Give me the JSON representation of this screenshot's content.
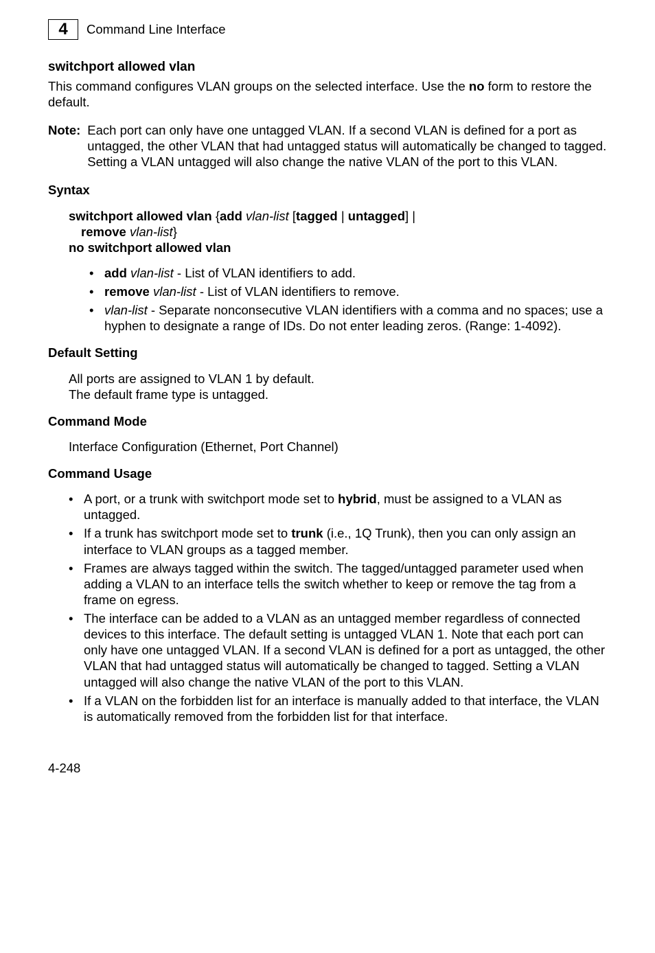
{
  "header": {
    "chapter_number": "4",
    "running_title": "Command Line Interface"
  },
  "title": "switchport allowed vlan",
  "intro": {
    "prefix": "This command configures VLAN groups on the selected interface. Use the ",
    "bold_word": "no ",
    "suffix": "form to restore the default."
  },
  "note": {
    "label": "Note:",
    "text": "Each port can only have one untagged VLAN. If a second VLAN is defined for a port as untagged, the other VLAN that had untagged status will automatically be changed to tagged.  Setting a VLAN untagged will also change the native VLAN of the port to this VLAN."
  },
  "syntax": {
    "heading": "Syntax",
    "line1": {
      "pre": "switchport allowed vlan",
      "open": " {",
      "add": "add",
      "sp1": " ",
      "vlist1": "vlan-list",
      "sp2": " [",
      "tagged": "tagged",
      "pipe1": " | ",
      "untagged": "untagged",
      "close1": "] |"
    },
    "line2": {
      "remove": "remove",
      "sp": " ",
      "vlist": "vlan-list",
      "close": "}"
    },
    "line3": "no switchport allowed vlan",
    "bullets": [
      {
        "bold": "add",
        "ital": " vlan-list",
        "rest": " - List of VLAN identifiers to add."
      },
      {
        "bold": "remove",
        "ital": " vlan-list",
        "rest": " - List of VLAN identifiers to remove."
      },
      {
        "bold": "",
        "ital": "vlan-list",
        "rest": " - Separate nonconsecutive VLAN identifiers with a comma and no spaces; use a hyphen to designate a range of IDs. Do not enter leading zeros. (Range: 1-4092)."
      }
    ]
  },
  "default_setting": {
    "heading": "Default Setting",
    "line1": "All ports are assigned to VLAN 1 by default.",
    "line2": "The default frame type is untagged."
  },
  "command_mode": {
    "heading": "Command Mode",
    "text": "Interface Configuration (Ethernet, Port Channel)"
  },
  "command_usage": {
    "heading": "Command Usage",
    "items": [
      {
        "pre": "A port, or a trunk with switchport mode set to ",
        "bold": "hybrid",
        "post": ", must be assigned to a VLAN as untagged."
      },
      {
        "pre": "If a trunk has switchport mode set to ",
        "bold": "trunk",
        "post": " (i.e., 1Q Trunk), then you can only assign an interface to VLAN groups as a tagged member."
      },
      {
        "pre": "Frames are always tagged within the switch. The tagged/untagged parameter used when adding a VLAN to an interface tells the switch whether to keep or remove the tag from a frame on egress.",
        "bold": "",
        "post": ""
      },
      {
        "pre": "The interface can be added to a VLAN as an untagged member regardless of connected devices to this interface. The default setting is untagged VLAN 1. Note that each port can only have one untagged VLAN. If a second VLAN is defined for a port as untagged, the other VLAN that had untagged status will automatically be changed to tagged.  Setting a VLAN untagged will also change the native VLAN of the port to this VLAN.",
        "bold": "",
        "post": ""
      },
      {
        "pre": "If a VLAN on the forbidden list for an interface is manually added to that interface, the VLAN is automatically removed from the forbidden list for that interface.",
        "bold": "",
        "post": ""
      }
    ]
  },
  "page_number": "4-248"
}
